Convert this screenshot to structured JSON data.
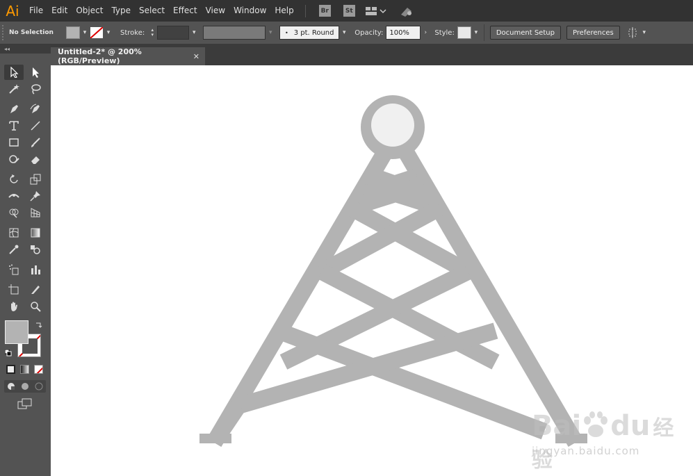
{
  "app": {
    "logo": "Ai"
  },
  "menu": {
    "items": [
      "File",
      "Edit",
      "Object",
      "Type",
      "Select",
      "Effect",
      "View",
      "Window",
      "Help"
    ]
  },
  "app_buttons": {
    "bridge": "Br",
    "stock": "St"
  },
  "control_bar": {
    "selection": "No Selection",
    "stroke_label": "Stroke:",
    "brush": "3 pt. Round",
    "opacity_label": "Opacity:",
    "opacity_value": "100%",
    "style_label": "Style:",
    "document_setup": "Document Setup",
    "preferences": "Preferences"
  },
  "panel": {
    "collapse": "◂◂"
  },
  "document_tab": {
    "title": "Untitled-2* @ 200% (RGB/Preview)",
    "close": "✕"
  },
  "colors": {
    "fill": "#b3b3b3",
    "artwork": "#b3b3b3",
    "ai_orange": "#ff9a00",
    "canvas": "#ffffff"
  },
  "watermark": {
    "brand_a": "Bai",
    "brand_b": "du",
    "cn": "经验",
    "url": "jingyan.baidu.com"
  }
}
